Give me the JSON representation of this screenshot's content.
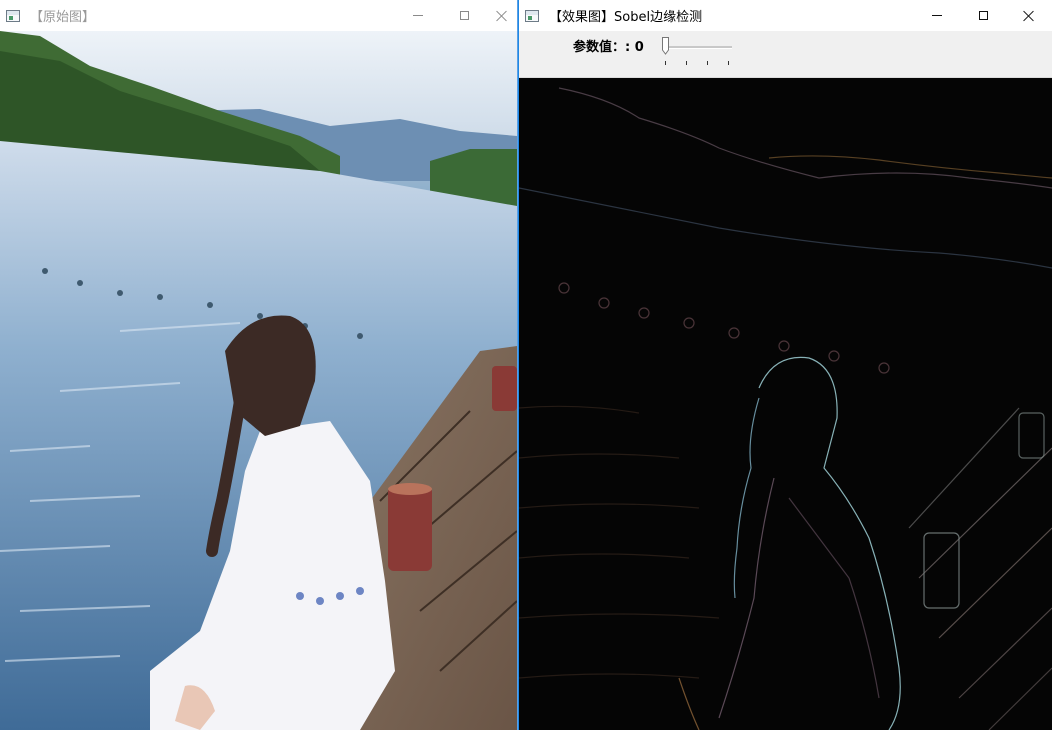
{
  "left_window": {
    "title": "【原始图】",
    "icon": "opencv-window-icon",
    "controls": [
      "minimize-icon",
      "maximize-icon",
      "close-icon"
    ]
  },
  "right_window": {
    "title": "【效果图】Sobel边缘检测",
    "icon": "opencv-window-icon",
    "controls": [
      "minimize-icon",
      "maximize-icon",
      "close-icon"
    ],
    "trackbar": {
      "label": "参数值：: 0",
      "value": 0,
      "tick_count": 4
    }
  },
  "colors": {
    "active_border": "#1e88e5",
    "toolbar_bg": "#f0f0f0",
    "edge_background": "#050505"
  }
}
